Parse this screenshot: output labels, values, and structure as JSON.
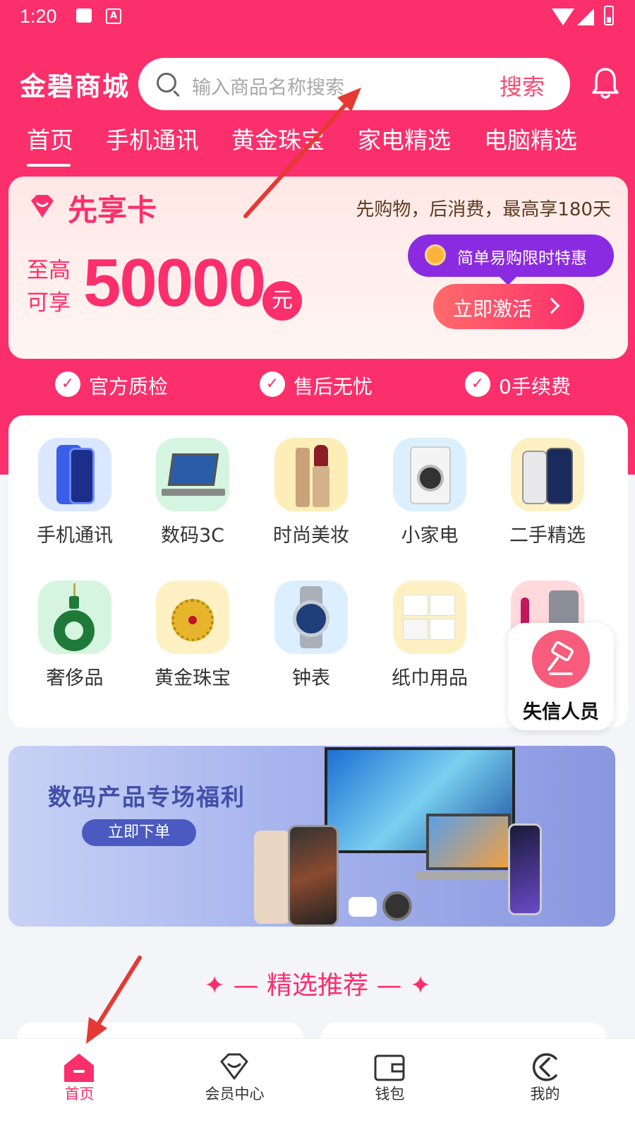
{
  "status_bar": {
    "time": "1:20",
    "a_badge": "A"
  },
  "header": {
    "brand": "金碧商城",
    "search_placeholder": "输入商品名称搜索",
    "search_button": "搜索"
  },
  "tabs": [
    "首页",
    "手机通讯",
    "黄金珠宝",
    "家电精选",
    "电脑精选"
  ],
  "credit_card": {
    "title": "先享卡",
    "slogan": "先购物，后消费，最高享180天",
    "upto": "至高可享",
    "amount": "50000",
    "unit": "元",
    "promo": "简单易购限时特惠",
    "activate": "立即激活"
  },
  "features": [
    "官方质检",
    "售后无忧",
    "0手续费"
  ],
  "categories": [
    {
      "label": "手机通讯",
      "icon": "phone-icon"
    },
    {
      "label": "数码3C",
      "icon": "laptop-icon"
    },
    {
      "label": "时尚美妆",
      "icon": "lipstick-icon"
    },
    {
      "label": "小家电",
      "icon": "washer-icon"
    },
    {
      "label": "二手精选",
      "icon": "used-phone-icon"
    },
    {
      "label": "奢侈品",
      "icon": "jade-pendant-icon"
    },
    {
      "label": "黄金珠宝",
      "icon": "gold-pendant-icon"
    },
    {
      "label": "钟表",
      "icon": "watch-icon"
    },
    {
      "label": "纸巾用品",
      "icon": "tissue-icon"
    },
    {
      "label": "",
      "icon": "appliance-icon"
    }
  ],
  "floating": {
    "label": "失信人员",
    "icon": "gavel-icon"
  },
  "banner": {
    "title": "数码产品专场福利",
    "button": "立即下单"
  },
  "section": {
    "title": "✦ — 精选推荐 — ✦"
  },
  "bottom_nav": [
    {
      "label": "首页",
      "icon": "home-icon",
      "active": true
    },
    {
      "label": "会员中心",
      "icon": "diamond-icon",
      "active": false
    },
    {
      "label": "钱包",
      "icon": "wallet-icon",
      "active": false
    },
    {
      "label": "我的",
      "icon": "profile-icon",
      "active": false
    }
  ],
  "colors": {
    "brand": "#fb2f6c",
    "promo": "#8a2be2",
    "banner": "#4150a8"
  }
}
